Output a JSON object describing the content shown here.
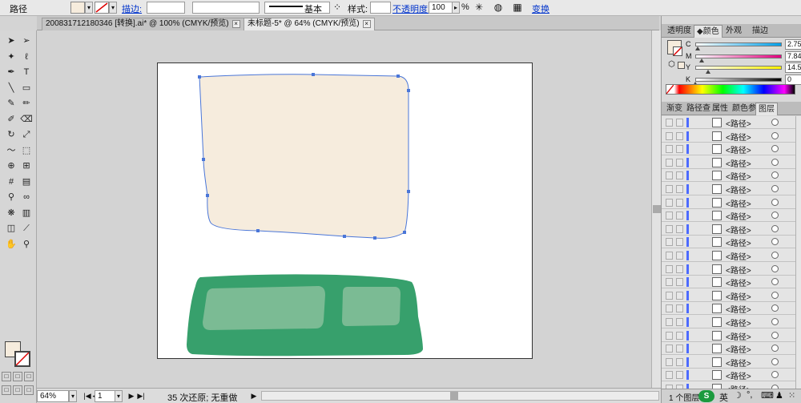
{
  "control_bar": {
    "object_type": "路径",
    "stroke_label": "描边:",
    "stroke_profile": "基本",
    "style_label": "样式:",
    "opacity_label": "不透明度:",
    "opacity_value": "100",
    "opacity_unit": "%",
    "transform_label": "变换"
  },
  "tabs": [
    {
      "title": "200831712180346 [转换].ai* @ 100% (CMYK/预览)",
      "active": false
    },
    {
      "title": "未标题-5* @ 64% (CMYK/预览)",
      "active": true
    }
  ],
  "tools": [
    "selection-tool",
    "direct-selection-tool",
    "magic-wand-tool",
    "lasso-tool",
    "pen-tool",
    "type-tool",
    "line-tool",
    "rectangle-tool",
    "paintbrush-tool",
    "pencil-tool",
    "blob-brush-tool",
    "eraser-tool",
    "rotate-tool",
    "scale-tool",
    "warp-tool",
    "free-transform-tool",
    "shape-builder-tool",
    "perspective-grid-tool",
    "mesh-tool",
    "gradient-tool",
    "eyedropper-tool",
    "blend-tool",
    "symbol-sprayer-tool",
    "column-graph-tool",
    "artboard-tool",
    "slice-tool",
    "hand-tool",
    "zoom-tool"
  ],
  "status": {
    "zoom": "64%",
    "artboard_num": "1",
    "message": "35 次还原; 无重做"
  },
  "color_panel": {
    "tabs": [
      "透明度",
      "颜色",
      "外观",
      "描边"
    ],
    "active_tab": "颜色",
    "channels": [
      {
        "label": "C",
        "value": "2.75",
        "unit": "%",
        "color": "#00a0e9"
      },
      {
        "label": "M",
        "value": "7.84",
        "unit": "%",
        "color": "#e4007f"
      },
      {
        "label": "Y",
        "value": "14.51",
        "unit": "%",
        "color": "#fff100"
      },
      {
        "label": "K",
        "value": "0",
        "unit": "%",
        "color": "#000000"
      }
    ],
    "fill_color": "#f6ecdd"
  },
  "layers_panel": {
    "tabs": [
      "渐变",
      "路径查",
      "属性",
      "颜色参",
      "图层"
    ],
    "active_tab": "图层",
    "rows": [
      "<路径>",
      "<路径>",
      "<路径>",
      "<路径>",
      "<路径>",
      "<路径>",
      "<路径>",
      "<路径>",
      "<路径>",
      "<路径>",
      "<路径>",
      "<路径>",
      "<路径>",
      "<路径>",
      "<路径>",
      "<路径>",
      "<路径>",
      "<路径>",
      "<路径>",
      "<路径>",
      "<路径>"
    ],
    "footer": "1 个图层",
    "ime_label": "英"
  },
  "artwork": {
    "top_shape_color": "#f6ecdd",
    "selection_color": "#4a76d8",
    "tray_color": "#37a06c",
    "inset_color": "#7bbb94"
  }
}
